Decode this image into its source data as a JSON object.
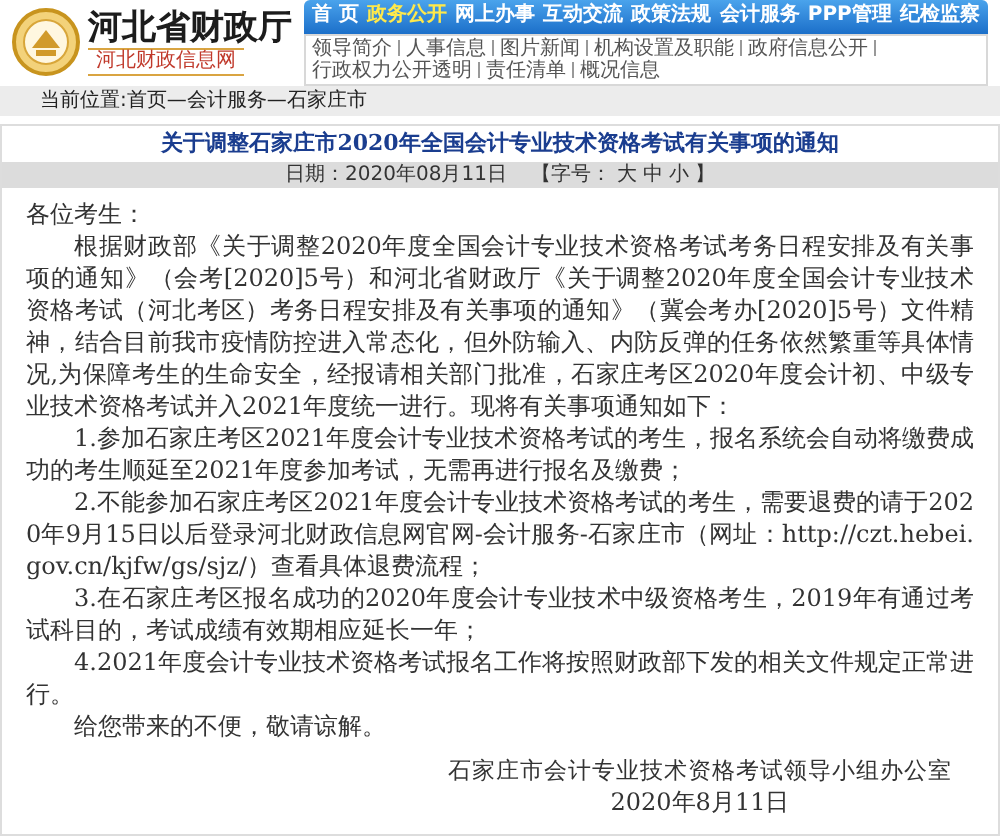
{
  "header": {
    "site_title": "河北省财政厅",
    "site_subtitle": "河北财政信息网",
    "nav": [
      {
        "label": "首 页",
        "selected": false
      },
      {
        "label": "政务公开",
        "selected": true
      },
      {
        "label": "网上办事",
        "selected": false
      },
      {
        "label": "互动交流",
        "selected": false
      },
      {
        "label": "政策法规",
        "selected": false
      },
      {
        "label": "会计服务",
        "selected": false
      },
      {
        "label": "PPP管理",
        "selected": false
      },
      {
        "label": "纪检监察",
        "selected": false
      }
    ],
    "subnav": [
      "领导简介",
      "人事信息",
      "图片新闻",
      "机构设置及职能",
      "政府信息公开",
      "行政权力公开透明",
      "责任清单",
      "概况信息"
    ]
  },
  "breadcrumb": "当前位置:首页—会计服务—石家庄市",
  "article": {
    "title": "关于调整石家庄市2020年全国会计专业技术资格考试有关事项的通知",
    "date": "日期：2020年08月11日",
    "font_size_label": "【字号：",
    "font_sizes": [
      "大",
      "中",
      "小"
    ],
    "font_size_close": "】",
    "greeting": "各位考生：",
    "paragraphs": [
      "根据财政部《关于调整2020年度全国会计专业技术资格考试考务日程安排及有关事项的通知》（会考[2020]5号）和河北省财政厅《关于调整2020年度全国会计专业技术资格考试（河北考区）考务日程安排及有关事项的通知》（冀会考办[2020]5号）文件精神，结合目前我市疫情防控进入常态化，但外防输入、内防反弹的任务依然繁重等具体情况,为保障考生的生命安全，经报请相关部门批准，石家庄考区2020年度会计初、中级专业技术资格考试并入2021年度统一进行。现将有关事项通知如下：",
      "1.参加石家庄考区2021年度会计专业技术资格考试的考生，报名系统会自动将缴费成功的考生顺延至2021年度参加考试，无需再进行报名及缴费；",
      "2.不能参加石家庄考区2021年度会计专业技术资格考试的考生，需要退费的请于2020年9月15日以后登录河北财政信息网官网-会计服务-石家庄市（网址：http://czt.hebei.gov.cn/kjfw/gs/sjz/）查看具体退费流程；",
      "3.在石家庄考区报名成功的2020年度会计专业技术中级资格考生，2019年有通过考试科目的，考试成绩有效期相应延长一年；",
      "4.2021年度会计专业技术资格考试报名工作将按照财政部下发的相关文件规定正常进行。",
      "给您带来的不便，敬请谅解。"
    ],
    "signature": {
      "org": "石家庄市会计专业技术资格考试领导小组办公室",
      "date": "2020年8月11日"
    }
  }
}
